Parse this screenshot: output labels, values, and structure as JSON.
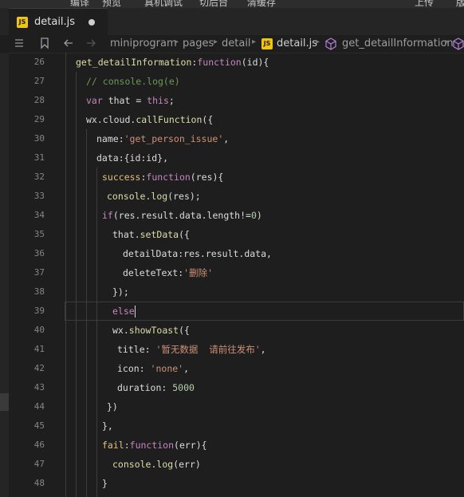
{
  "menu": [
    "编译",
    "预览",
    "真机调试",
    "切后台",
    "清缓存",
    "上传",
    "版"
  ],
  "tab": {
    "title": "detail.js",
    "icon": "js-file-icon"
  },
  "breadcrumb": {
    "items": [
      "miniprogram",
      "pages",
      "detail",
      "detail.js",
      "get_detailInformation"
    ],
    "file_badge": "JS"
  },
  "editor": {
    "line_numbers": [
      "26",
      "27",
      "28",
      "29",
      "30",
      "31",
      "32",
      "33",
      "34",
      "35",
      "36",
      "37",
      "38",
      "39",
      "40",
      "41",
      "42",
      "43",
      "44",
      "45",
      "46",
      "47",
      "48"
    ],
    "lines": [
      {
        "indent": 32,
        "tokens": [
          [
            "f",
            "get_detailInformation"
          ],
          [
            "p",
            ":"
          ],
          [
            "kw",
            "function"
          ],
          [
            "p",
            "(id){"
          ]
        ]
      },
      {
        "indent": 45,
        "tokens": [
          [
            "c",
            "// console.log(e)"
          ]
        ]
      },
      {
        "indent": 45,
        "tokens": [
          [
            "kw",
            "var"
          ],
          [
            "p",
            " that = "
          ],
          [
            "kw",
            "this"
          ],
          [
            "p",
            ";"
          ]
        ]
      },
      {
        "indent": 45,
        "tokens": [
          [
            "p",
            "wx.cloud."
          ],
          [
            "f",
            "callFunction"
          ],
          [
            "p",
            "({"
          ]
        ]
      },
      {
        "indent": 58,
        "tokens": [
          [
            "p",
            "name:"
          ],
          [
            "s",
            "'get_person_issue'"
          ],
          [
            "p",
            ","
          ]
        ]
      },
      {
        "indent": 58,
        "tokens": [
          [
            "p",
            "data:{id:id},"
          ]
        ]
      },
      {
        "indent": 65,
        "tokens": [
          [
            "fy",
            "success"
          ],
          [
            "p",
            ":"
          ],
          [
            "kw",
            "function"
          ],
          [
            "p",
            "(res){"
          ]
        ]
      },
      {
        "indent": 71,
        "tokens": [
          [
            "f",
            "console"
          ],
          [
            "p",
            "."
          ],
          [
            "f",
            "log"
          ],
          [
            "p",
            "(res);"
          ]
        ]
      },
      {
        "indent": 65,
        "tokens": [
          [
            "kw",
            "if"
          ],
          [
            "p",
            "(res.result.data.length!="
          ],
          [
            "n",
            "0"
          ],
          [
            "p",
            ")"
          ]
        ]
      },
      {
        "indent": 78,
        "tokens": [
          [
            "p",
            "that."
          ],
          [
            "f",
            "setData"
          ],
          [
            "p",
            "({"
          ]
        ]
      },
      {
        "indent": 91,
        "tokens": [
          [
            "p",
            "detailData:res.result.data,"
          ]
        ]
      },
      {
        "indent": 91,
        "tokens": [
          [
            "p",
            "deleteText:"
          ],
          [
            "s",
            "'删除'"
          ]
        ]
      },
      {
        "indent": 78,
        "tokens": [
          [
            "p",
            "});"
          ]
        ]
      },
      {
        "indent": 78,
        "tokens": [
          [
            "kw",
            "else"
          ]
        ]
      },
      {
        "indent": 78,
        "tokens": [
          [
            "p",
            "wx."
          ],
          [
            "f",
            "showToast"
          ],
          [
            "p",
            "({"
          ]
        ]
      },
      {
        "indent": 84,
        "tokens": [
          [
            "p",
            "title: "
          ],
          [
            "s",
            "'暂无数据  请前往发布'"
          ],
          [
            "p",
            ","
          ]
        ]
      },
      {
        "indent": 84,
        "tokens": [
          [
            "p",
            "icon: "
          ],
          [
            "s",
            "'none'"
          ],
          [
            "p",
            ","
          ]
        ]
      },
      {
        "indent": 84,
        "tokens": [
          [
            "p",
            "duration: "
          ],
          [
            "n",
            "5000"
          ]
        ]
      },
      {
        "indent": 71,
        "tokens": [
          [
            "p",
            "})"
          ]
        ]
      },
      {
        "indent": 65,
        "tokens": [
          [
            "p",
            "},"
          ]
        ]
      },
      {
        "indent": 65,
        "tokens": [
          [
            "fy",
            "fail"
          ],
          [
            "p",
            ":"
          ],
          [
            "kw",
            "function"
          ],
          [
            "p",
            "(err){"
          ]
        ]
      },
      {
        "indent": 78,
        "tokens": [
          [
            "f",
            "console"
          ],
          [
            "p",
            "."
          ],
          [
            "f",
            "log"
          ],
          [
            "p",
            "(err)"
          ]
        ]
      },
      {
        "indent": 65,
        "tokens": [
          [
            "p",
            "}"
          ]
        ]
      }
    ]
  }
}
